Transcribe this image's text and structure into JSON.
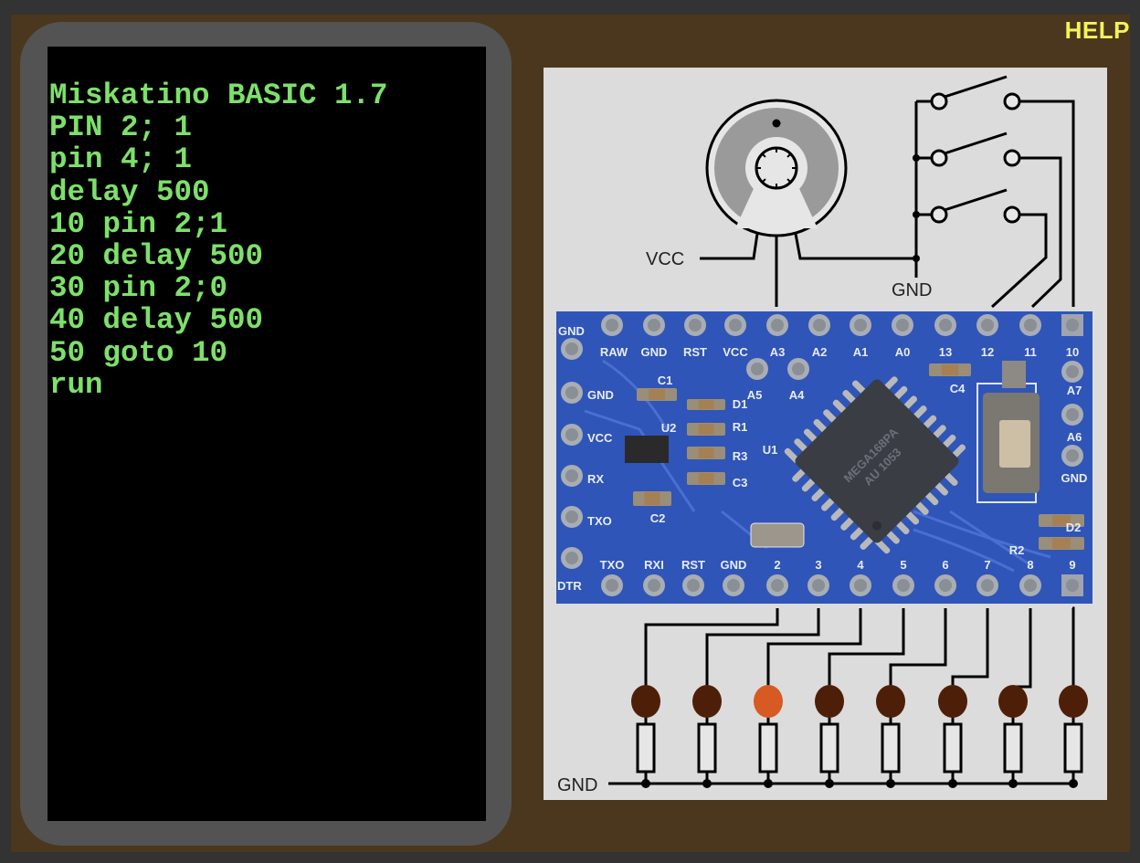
{
  "help_label": "HELP",
  "terminal": {
    "lines": [
      "Miskatino BASIC 1.7",
      "PIN 2; 1",
      "pin 4; 1",
      "delay 500",
      "10 pin 2;1",
      "20 delay 500",
      "30 pin 2;0",
      "40 delay 500",
      "50 goto 10",
      "run"
    ]
  },
  "schematic": {
    "vcc_label": "VCC",
    "gnd_label_top": "GND",
    "gnd_label_bottom": "GND",
    "switches": [
      {
        "name": "switch-1",
        "state": "open"
      },
      {
        "name": "switch-2",
        "state": "open"
      },
      {
        "name": "switch-3",
        "state": "open"
      }
    ],
    "board": {
      "top_pins": [
        "RAW",
        "GND",
        "RST",
        "VCC",
        "A3",
        "A2",
        "A1",
        "A0",
        "13",
        "12",
        "11",
        "10"
      ],
      "left_pins": [
        "GND",
        "GND",
        "VCC",
        "RX",
        "TXO",
        "DTR"
      ],
      "inner_pins": [
        "A5",
        "A4"
      ],
      "right_pins": [
        "A7",
        "A6",
        "GND"
      ],
      "bottom_pins": [
        "TXO",
        "RXI",
        "RST",
        "GND",
        "2",
        "3",
        "4",
        "5",
        "6",
        "7",
        "8",
        "9"
      ],
      "components": [
        "C1",
        "U2",
        "D1",
        "R1",
        "R3",
        "C3",
        "C2",
        "C4",
        "U1",
        "D2",
        "R2"
      ],
      "chip_text": [
        "MEGA168PA",
        "AU 1053"
      ]
    },
    "leds": [
      {
        "pin": "2",
        "on": false
      },
      {
        "pin": "3",
        "on": false
      },
      {
        "pin": "4",
        "on": true
      },
      {
        "pin": "5",
        "on": false
      },
      {
        "pin": "6",
        "on": false
      },
      {
        "pin": "7",
        "on": false
      },
      {
        "pin": "8",
        "on": false
      },
      {
        "pin": "9",
        "on": false
      }
    ],
    "colors": {
      "led_on": "#d65a22",
      "led_off": "#4e1f08",
      "board": "#2f55b8",
      "wire": "#000000"
    }
  }
}
